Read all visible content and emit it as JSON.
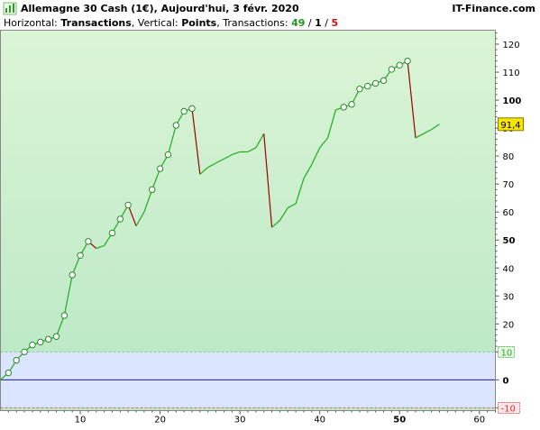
{
  "header": {
    "title": "Allemagne 30 Cash (1€), Aujourd'hui, 3 févr. 2020",
    "source": "IT-Finance.com",
    "sub_prefix": "Horizontal: ",
    "sub_h": "Transactions",
    "sub_mid": ", Vertical: ",
    "sub_v": "Points",
    "sub_tx": ", Transactions: ",
    "tx_total": "49",
    "tx_sep1": " / ",
    "tx_wins": "1",
    "tx_sep2": " / ",
    "tx_losses": "5",
    "icon": "bar-chart-icon"
  },
  "chart_data": {
    "type": "line",
    "title": "Allemagne 30 Cash (1€), Aujourd'hui, 3 févr. 2020",
    "xlabel": "Transactions",
    "ylabel": "Points",
    "xlim": [
      0,
      62
    ],
    "ylim": [
      -11,
      125
    ],
    "xticks": [
      10,
      20,
      30,
      40,
      50,
      60
    ],
    "xticks_bold": [
      50
    ],
    "yticks": [
      20,
      30,
      40,
      50,
      60,
      70,
      80,
      90,
      100,
      110,
      120
    ],
    "yticks_bold": [
      50,
      100
    ],
    "grid": false,
    "colors": {
      "up": "#22aa22",
      "down": "#990000",
      "marker_fill": "#ffffff",
      "marker_edge": "#2a8a2a",
      "plot_top": "#dbf5d6",
      "plot_bottom": "#b8e7c4",
      "band": "#dbe5ff",
      "zero_line": "#1a1aa8",
      "band_top_line": "#88cc88",
      "band_bottom_line": "#dd6677",
      "last_label_bg": "#f4e400"
    },
    "band_levels": [
      {
        "value": 10,
        "label": "10",
        "color": "#22aa22"
      },
      {
        "value": 0,
        "label": "0",
        "color": "#1a1aa8"
      },
      {
        "value": -10,
        "label": "-10",
        "color": "#dd3333"
      }
    ],
    "last_value": 91.4,
    "last_label": "91,4",
    "series": [
      {
        "points": [
          {
            "x": 0,
            "y": 0
          },
          {
            "x": 1,
            "y": 2.5,
            "m": 1
          },
          {
            "x": 2,
            "y": 7,
            "m": 1
          },
          {
            "x": 3,
            "y": 10,
            "m": 1
          },
          {
            "x": 4,
            "y": 12.5,
            "m": 1
          },
          {
            "x": 5,
            "y": 13.5,
            "m": 1
          },
          {
            "x": 6,
            "y": 14.5,
            "m": 1
          },
          {
            "x": 7,
            "y": 15.5,
            "m": 1
          },
          {
            "x": 8,
            "y": 23,
            "m": 1
          },
          {
            "x": 9,
            "y": 37.5,
            "m": 1
          },
          {
            "x": 10,
            "y": 44.5,
            "m": 1
          },
          {
            "x": 11,
            "y": 49.5,
            "m": 1
          },
          {
            "x": 12,
            "y": 47
          },
          {
            "x": 13,
            "y": 48
          },
          {
            "x": 14,
            "y": 52.5,
            "m": 1
          },
          {
            "x": 15,
            "y": 57.5,
            "m": 1
          },
          {
            "x": 16,
            "y": 62.5,
            "m": 1
          },
          {
            "x": 17,
            "y": 55
          },
          {
            "x": 18,
            "y": 60
          },
          {
            "x": 19,
            "y": 68,
            "m": 1
          },
          {
            "x": 20,
            "y": 75.5,
            "m": 1
          },
          {
            "x": 21,
            "y": 80.5,
            "m": 1
          },
          {
            "x": 22,
            "y": 91,
            "m": 1
          },
          {
            "x": 23,
            "y": 96,
            "m": 1
          },
          {
            "x": 24,
            "y": 97,
            "m": 1
          },
          {
            "x": 25,
            "y": 73.5
          },
          {
            "x": 26,
            "y": 76
          },
          {
            "x": 27,
            "y": 77.5
          },
          {
            "x": 28,
            "y": 79
          },
          {
            "x": 29,
            "y": 80.5
          },
          {
            "x": 30,
            "y": 81.5
          },
          {
            "x": 31,
            "y": 81.5
          },
          {
            "x": 32,
            "y": 83
          },
          {
            "x": 33,
            "y": 88
          },
          {
            "x": 34,
            "y": 54.5
          },
          {
            "x": 35,
            "y": 57
          },
          {
            "x": 36,
            "y": 61.5
          },
          {
            "x": 37,
            "y": 63
          },
          {
            "x": 38,
            "y": 72
          },
          {
            "x": 39,
            "y": 77
          },
          {
            "x": 40,
            "y": 83
          },
          {
            "x": 41,
            "y": 86.5
          },
          {
            "x": 42,
            "y": 96.5
          },
          {
            "x": 43,
            "y": 97.5,
            "m": 1
          },
          {
            "x": 44,
            "y": 98.5,
            "m": 1
          },
          {
            "x": 45,
            "y": 104,
            "m": 1
          },
          {
            "x": 46,
            "y": 105,
            "m": 1
          },
          {
            "x": 47,
            "y": 106,
            "m": 1
          },
          {
            "x": 48,
            "y": 107,
            "m": 1
          },
          {
            "x": 49,
            "y": 111,
            "m": 1
          },
          {
            "x": 50,
            "y": 112.5,
            "m": 1
          },
          {
            "x": 51,
            "y": 114,
            "m": 1
          },
          {
            "x": 52,
            "y": 86.5
          },
          {
            "x": 53,
            "y": 88
          },
          {
            "x": 54,
            "y": 89.5
          },
          {
            "x": 55,
            "y": 91.4
          }
        ]
      }
    ]
  }
}
